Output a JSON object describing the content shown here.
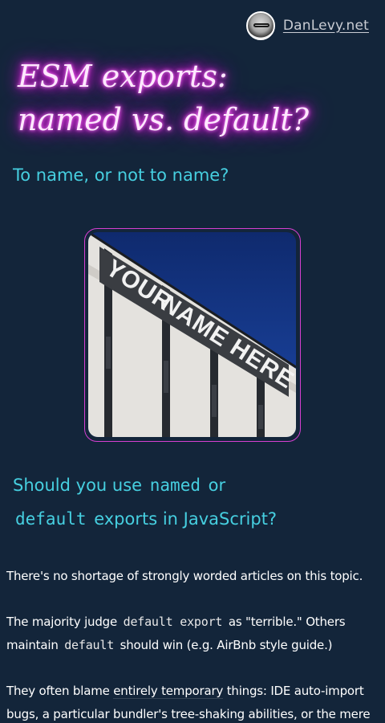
{
  "header": {
    "site_name": "DanLevy.net",
    "avatar_icon": "author-avatar"
  },
  "hero": {
    "title_line1": "ESM exports:",
    "title_line2": "named vs. default?",
    "subtitle": "To name, or not to name?",
    "image_sign_text_line1": "YOUR",
    "image_sign_text_line2": "NAME HERE"
  },
  "question": {
    "pre": "Should you use",
    "code1": "named",
    "mid": "or",
    "code2": "default",
    "post": "exports in JavaScript?"
  },
  "article": {
    "p1": "There's no shortage of strongly worded articles on this topic.",
    "p2_pre": "The majority judge",
    "p2_code1": "default export",
    "p2_mid": "as \"terrible.\" Others maintain",
    "p2_code2": "default",
    "p2_post": "should win (e.g. AirBnb style guide.)",
    "p3_pre": "They often blame",
    "p3_em": "entirely temporary",
    "p3_post": "things: IDE auto-import bugs, a particular bundler's tree-shaking abilities, or the mere"
  },
  "colors": {
    "background": "#13253a",
    "accent_cyan": "#46cfe0",
    "neon_pink": "#ff2cf0",
    "frame_border": "#d63fd1"
  }
}
